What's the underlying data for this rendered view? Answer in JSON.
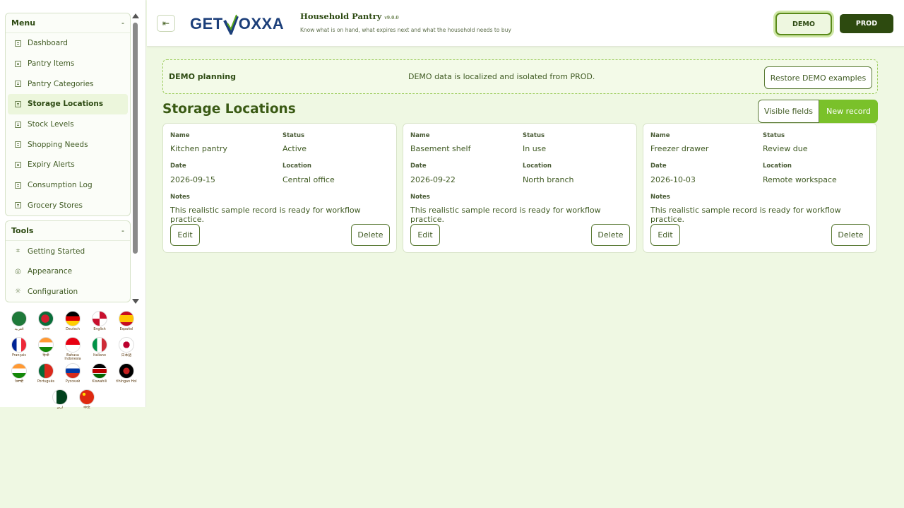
{
  "sidebar": {
    "menu": {
      "title": "Menu",
      "collapse": "-",
      "items": [
        {
          "label": "Dashboard",
          "active": false
        },
        {
          "label": "Pantry Items",
          "active": false
        },
        {
          "label": "Pantry Categories",
          "active": false
        },
        {
          "label": "Storage Locations",
          "active": true
        },
        {
          "label": "Stock Levels",
          "active": false
        },
        {
          "label": "Shopping Needs",
          "active": false
        },
        {
          "label": "Expiry Alerts",
          "active": false
        },
        {
          "label": "Consumption Log",
          "active": false
        },
        {
          "label": "Grocery Stores",
          "active": false
        }
      ]
    },
    "tools": {
      "title": "Tools",
      "collapse": "-",
      "items": [
        {
          "label": "Getting Started",
          "icon": "crop-icon"
        },
        {
          "label": "Appearance",
          "icon": "palette-icon"
        },
        {
          "label": "Configuration",
          "icon": "gear-icon"
        }
      ]
    }
  },
  "languages": [
    {
      "label": "العربية",
      "icon": "flag-sa-icon",
      "bg": "radial-gradient(circle,#1f7a3a 60%,#0f5a2a)"
    },
    {
      "label": "বাংলা",
      "icon": "flag-bd-icon",
      "bg": "radial-gradient(circle at 45% 50%,#d21f2f 0 38%,#0a6e3a 40%)"
    },
    {
      "label": "Deutsch",
      "icon": "flag-de-icon",
      "bg": "linear-gradient(#000 0 33%,#dd0000 33% 66%,#ffce00 66%)"
    },
    {
      "label": "English",
      "icon": "flag-gb-icon",
      "bg": "conic-gradient(#c8102e 0 25%,#fff 0 50%,#c8102e 0 75%,#fff 0),radial-gradient(#012169,#012169)"
    },
    {
      "label": "Español",
      "icon": "flag-es-icon",
      "bg": "linear-gradient(#c60b1e 0 25%,#ffc400 25% 75%,#c60b1e 75%)"
    },
    {
      "label": "Français",
      "icon": "flag-fr-icon",
      "bg": "linear-gradient(90deg,#002395 0 33%,#fff 33% 66%,#ed2939 66%)"
    },
    {
      "label": "हिन्दी",
      "icon": "flag-in-icon",
      "bg": "linear-gradient(#ff9933 0 33%,#fff 33% 66%,#138808 66%)"
    },
    {
      "label": "Bahasa Indonesia",
      "icon": "flag-id-icon",
      "bg": "linear-gradient(#e70011 0 50%,#fff 50%)"
    },
    {
      "label": "Italiano",
      "icon": "flag-it-icon",
      "bg": "linear-gradient(90deg,#009246 0 33%,#fff 33% 66%,#ce2b37 66%)"
    },
    {
      "label": "日本語",
      "icon": "flag-jp-icon",
      "bg": "radial-gradient(circle,#bc002d 0 32%,#fff 34%)"
    },
    {
      "label": "ਪੰਜਾਬੀ",
      "icon": "flag-in-icon",
      "bg": "linear-gradient(#ff9933 0 33%,#fff 33% 66%,#138808 66%)"
    },
    {
      "label": "Português",
      "icon": "flag-pt-icon",
      "bg": "linear-gradient(90deg,#046a38 0 40%,#da291c 40%)"
    },
    {
      "label": "Русский",
      "icon": "flag-ru-icon",
      "bg": "linear-gradient(#fff 0 33%,#0039a6 33% 66%,#d52b1e 66%)"
    },
    {
      "label": "Kiswahili",
      "icon": "flag-ke-icon",
      "bg": "linear-gradient(#000 0 30%,#fff 30% 35%,#bb0000 35% 65%,#fff 65% 70%,#006600 70%)"
    },
    {
      "label": "tlhIngan Hol",
      "icon": "flag-klingon-icon",
      "bg": "radial-gradient(circle,#c41e1e 0 30%,#000 34%)"
    },
    {
      "label": "اردو",
      "icon": "flag-pk-icon",
      "bg": "linear-gradient(90deg,#fff 0 25%,#01411c 25%)"
    },
    {
      "label": "中文",
      "icon": "flag-cn-icon",
      "bg": "radial-gradient(circle at 30% 30%,#ffde00 0 10%,#de2910 12%)"
    }
  ],
  "header": {
    "toggle_icon": "⇤",
    "logo_text": {
      "get": "GET",
      "v": "V",
      "rest": "OXXA"
    },
    "title": "Household Pantry",
    "version": "v9.0.0",
    "subtitle": "Know what is on hand, what expires next and what the household needs to buy",
    "env_demo": "DEMO",
    "env_prod": "PROD"
  },
  "banner": {
    "title": "DEMO planning",
    "message": "DEMO data is localized and isolated from PROD.",
    "button": "Restore DEMO examples"
  },
  "page": {
    "title": "Storage Locations",
    "visible_fields": "Visible fields",
    "new_record": "New record"
  },
  "field_labels": {
    "name": "Name",
    "status": "Status",
    "date": "Date",
    "location": "Location",
    "notes": "Notes",
    "edit": "Edit",
    "delete": "Delete"
  },
  "records": [
    {
      "name": "Kitchen pantry",
      "status": "Active",
      "date": "2026-09-15",
      "location": "Central office",
      "notes": "This realistic sample record is ready for workflow practice."
    },
    {
      "name": "Basement shelf",
      "status": "In use",
      "date": "2026-09-22",
      "location": "North branch",
      "notes": "This realistic sample record is ready for workflow practice."
    },
    {
      "name": "Freezer drawer",
      "status": "Review due",
      "date": "2026-10-03",
      "location": "Remote workspace",
      "notes": "This realistic sample record is ready for workflow practice."
    }
  ]
}
